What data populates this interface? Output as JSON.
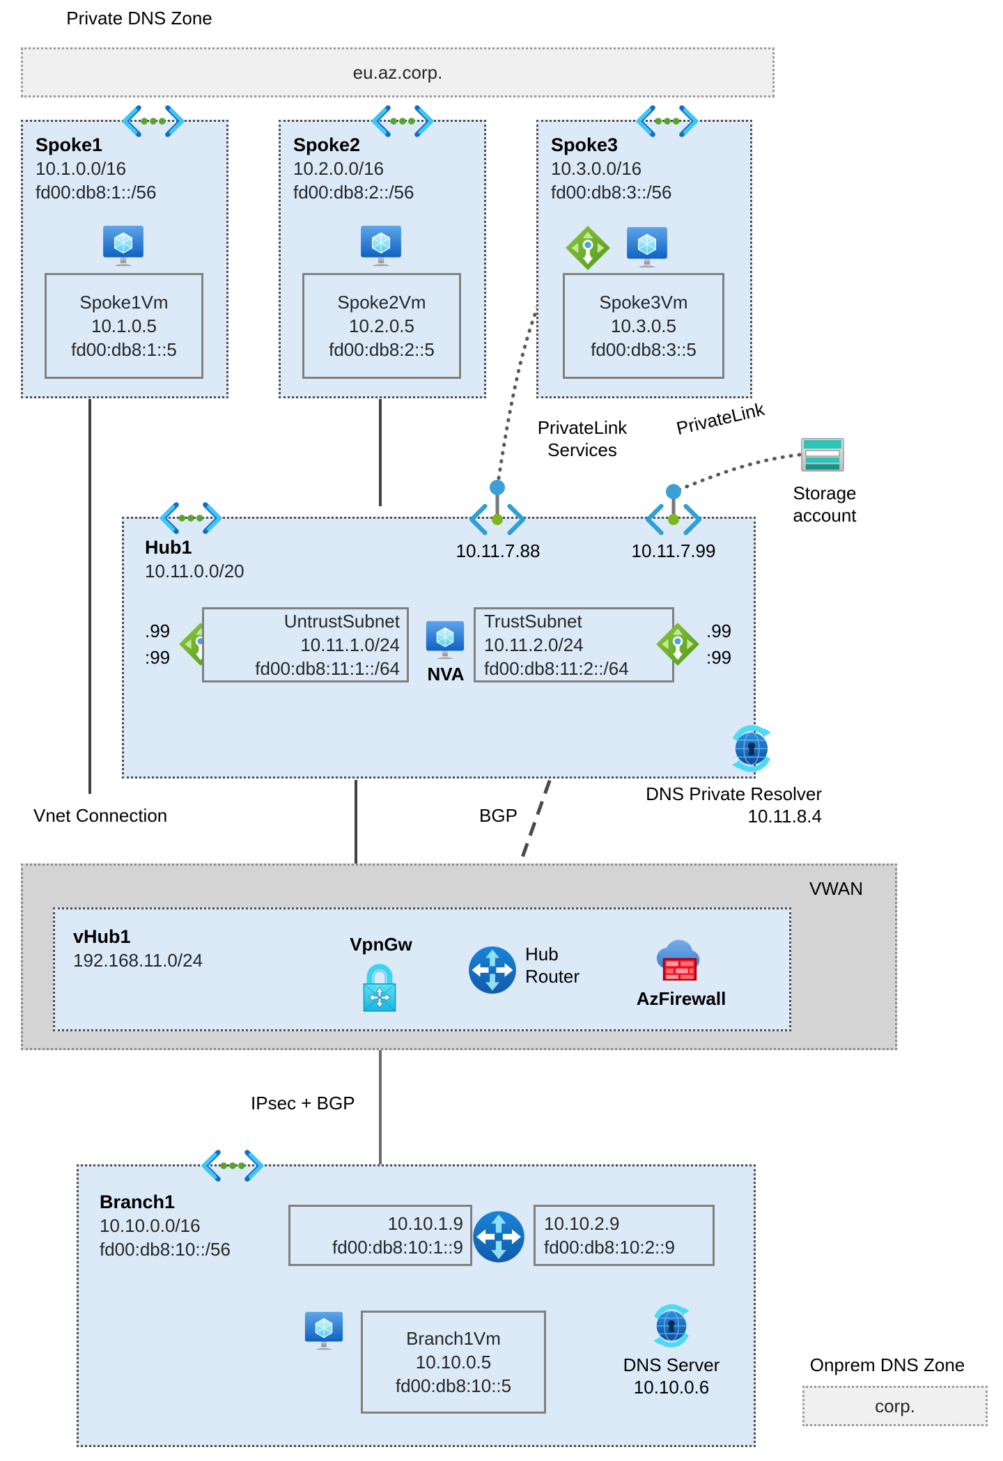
{
  "diagram": {
    "title_private_dns_zone": "Private DNS Zone",
    "private_dns_zone_name": "eu.az.corp.",
    "title_onprem_dns_zone": "Onprem DNS Zone",
    "onprem_dns_zone_name": "corp.",
    "vwan_label": "VWAN"
  },
  "spokes": [
    {
      "name": "Spoke1",
      "cidr4": "10.1.0.0/16",
      "cidr6": "fd00:db8:1::/56",
      "vm_name": "Spoke1Vm",
      "vm_ip4": "10.1.0.5",
      "vm_ip6": "fd00:db8:1::5"
    },
    {
      "name": "Spoke2",
      "cidr4": "10.2.0.0/16",
      "cidr6": "fd00:db8:2::/56",
      "vm_name": "Spoke2Vm",
      "vm_ip4": "10.2.0.5",
      "vm_ip6": "fd00:db8:2::5"
    },
    {
      "name": "Spoke3",
      "cidr4": "10.3.0.0/16",
      "cidr6": "fd00:db8:3::/56",
      "vm_name": "Spoke3Vm",
      "vm_ip4": "10.3.0.5",
      "vm_ip6": "fd00:db8:3::5"
    }
  ],
  "hub": {
    "name": "Hub1",
    "cidr4": "10.11.0.0/20",
    "untrust": {
      "name": "UntrustSubnet",
      "cidr4": "10.11.1.0/24",
      "cidr6": "fd00:db8:11:1::/64"
    },
    "trust": {
      "name": "TrustSubnet",
      "cidr4": "10.11.2.0/24",
      "cidr6": "fd00:db8:11:2::/64"
    },
    "nva_label": "NVA",
    "left_router_v4": ".99",
    "left_router_v6": ":99",
    "right_router_v4": ".99",
    "right_router_v6": ":99",
    "pe_ip_1": "10.11.7.88",
    "pe_ip_2": "10.11.7.99",
    "resolver_label": "DNS Private Resolver",
    "resolver_ip": "10.11.8.4"
  },
  "connectors": {
    "privatelink_services": "PrivateLink\nServices",
    "privatelink_services_line1": "PrivateLink",
    "privatelink_services_line2": "Services",
    "privatelink": "PrivateLink",
    "vnet_connection": "Vnet Connection",
    "bgp": "BGP",
    "ipsec_bgp": "IPsec + BGP"
  },
  "storage": {
    "label_line1": "Storage",
    "label_line2": "account"
  },
  "vwan": {
    "vhub_name": "vHub1",
    "vhub_cidr": "192.168.11.0/24",
    "vpngw_label": "VpnGw",
    "hub_router_line1": "Hub",
    "hub_router_line2": "Router",
    "azfirewall_label": "AzFirewall"
  },
  "branch": {
    "name": "Branch1",
    "cidr4": "10.10.0.0/16",
    "cidr6": "fd00:db8:10::/56",
    "iface_left_ip4": "10.10.1.9",
    "iface_left_ip6": "fd00:db8:10:1::9",
    "iface_right_ip4": "10.10.2.9",
    "iface_right_ip6": "fd00:db8:10:2::9",
    "vm_name": "Branch1Vm",
    "vm_ip4": "10.10.0.5",
    "vm_ip6": "fd00:db8:10::5",
    "dns_server_label": "DNS Server",
    "dns_server_ip": "10.10.0.6"
  },
  "icons": {
    "vm": "virtual-machine-icon",
    "router": "route-table-icon",
    "vnet_peering": "vnet-connector-icon",
    "private_endpoint": "private-endpoint-icon",
    "dns_resolver": "dns-private-resolver-icon",
    "storage": "storage-account-icon",
    "vpn_gateway": "vpn-gateway-icon",
    "hub_router": "hub-router-icon",
    "firewall": "azure-firewall-icon",
    "dns_server": "dns-server-icon"
  },
  "colors": {
    "vnet_fill": "#dce9f7",
    "vwan_fill": "#d4d4d4",
    "dnszone_fill": "#f0f0f0",
    "border_dotted": "#4d4d4d",
    "azure_blue": "#0078d4",
    "green": "#7fba00",
    "cyan": "#32c8f0",
    "teal": "#2bb3a8",
    "red": "#e81123"
  }
}
